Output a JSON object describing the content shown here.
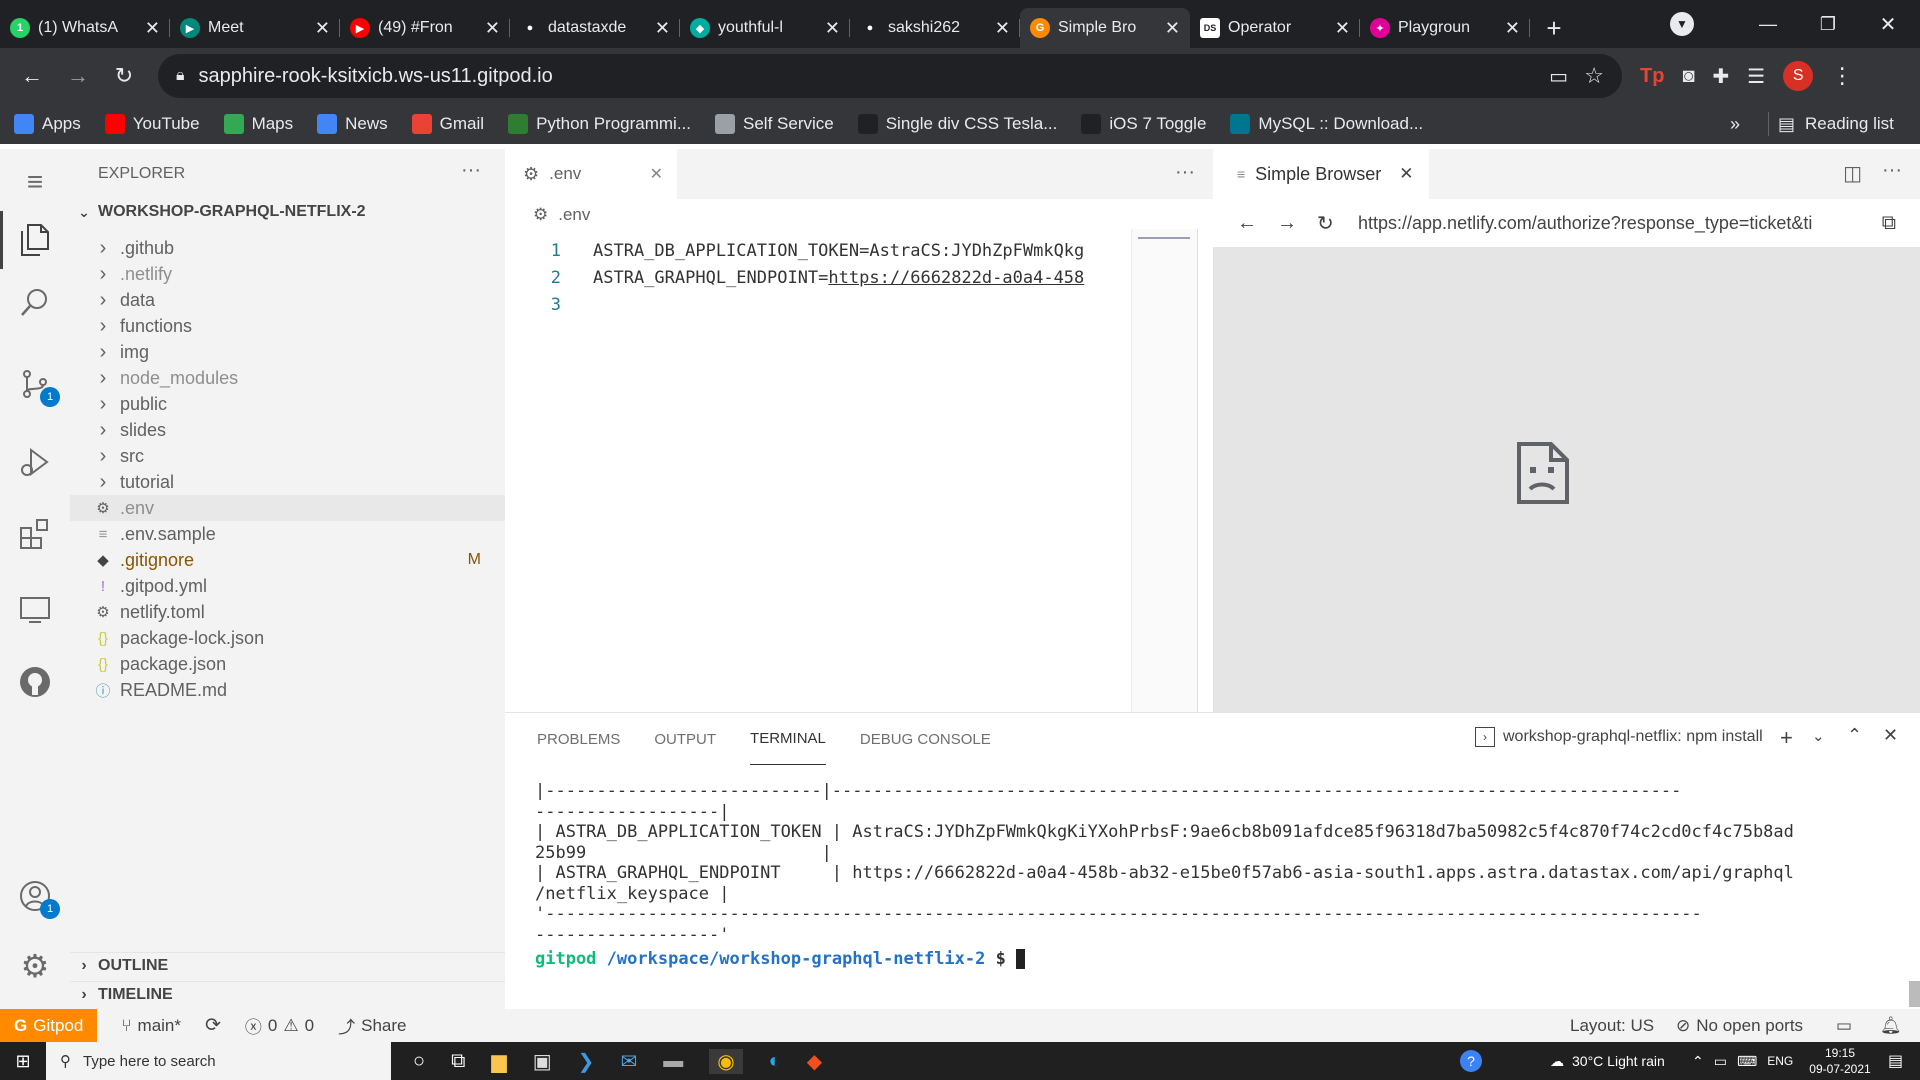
{
  "chrome": {
    "tabs": [
      {
        "title": "(1) WhatsA",
        "color": "#25d366",
        "glyph": "1"
      },
      {
        "title": "Meet",
        "color": "#00897b",
        "glyph": "▶"
      },
      {
        "title": "(49) #Fron",
        "color": "#ff0000",
        "glyph": "▶"
      },
      {
        "title": "datastaxde",
        "color": "#202124",
        "glyph": "●"
      },
      {
        "title": "youthful-l",
        "color": "#00ad9f",
        "glyph": "◆"
      },
      {
        "title": "sakshi262",
        "color": "#202124",
        "glyph": "●"
      },
      {
        "title": "Simple Bro",
        "color": "#ff8a00",
        "glyph": "G",
        "active": true
      },
      {
        "title": "Operator",
        "color": "#ffffff",
        "glyph": "DS"
      },
      {
        "title": "Playgroun",
        "color": "#e10098",
        "glyph": "✦"
      }
    ],
    "url": "sapphire-rook-ksitxicb.ws-us11.gitpod.io",
    "profile_initial": "S",
    "bookmarks": [
      {
        "label": "Apps",
        "icon": "apps-grid-icon",
        "color": "#4285f4"
      },
      {
        "label": "YouTube",
        "icon": "youtube-icon",
        "color": "#ff0000"
      },
      {
        "label": "Maps",
        "icon": "maps-icon",
        "color": "#34a853"
      },
      {
        "label": "News",
        "icon": "news-icon",
        "color": "#4285f4"
      },
      {
        "label": "Gmail",
        "icon": "gmail-icon",
        "color": "#ea4335"
      },
      {
        "label": "Python Programmi...",
        "icon": "python-icon",
        "color": "#2e7d32"
      },
      {
        "label": "Self Service",
        "icon": "globe-icon",
        "color": "#9aa0a6"
      },
      {
        "label": "Single div CSS Tesla...",
        "icon": "codepen-icon",
        "color": "#202124"
      },
      {
        "label": "iOS 7 Toggle",
        "icon": "codepen-icon",
        "color": "#202124"
      },
      {
        "label": "MySQL :: Download...",
        "icon": "mysql-icon",
        "color": "#00758f"
      }
    ],
    "reading_list": "Reading list"
  },
  "explorer": {
    "title": "EXPLORER",
    "project": "WORKSHOP-GRAPHQL-NETFLIX-2",
    "items": [
      {
        "name": ".github",
        "type": "folder"
      },
      {
        "name": ".netlify",
        "type": "folder",
        "dim": true
      },
      {
        "name": "data",
        "type": "folder"
      },
      {
        "name": "functions",
        "type": "folder"
      },
      {
        "name": "img",
        "type": "folder"
      },
      {
        "name": "node_modules",
        "type": "folder",
        "dim": true
      },
      {
        "name": "public",
        "type": "folder"
      },
      {
        "name": "slides",
        "type": "folder"
      },
      {
        "name": "src",
        "type": "folder"
      },
      {
        "name": "tutorial",
        "type": "folder"
      },
      {
        "name": ".env",
        "type": "file",
        "icon": "gear-icon",
        "dim": true,
        "selected": true
      },
      {
        "name": ".env.sample",
        "type": "file",
        "icon": "lines-icon"
      },
      {
        "name": ".gitignore",
        "type": "file",
        "icon": "git-icon",
        "color": "#895503",
        "badge": "M"
      },
      {
        "name": ".gitpod.yml",
        "type": "file",
        "icon": "exclaim-icon"
      },
      {
        "name": "netlify.toml",
        "type": "file",
        "icon": "gear-icon"
      },
      {
        "name": "package-lock.json",
        "type": "file",
        "icon": "braces-icon"
      },
      {
        "name": "package.json",
        "type": "file",
        "icon": "braces-icon"
      },
      {
        "name": "README.md",
        "type": "file",
        "icon": "info-icon"
      }
    ],
    "outline": "OUTLINE",
    "timeline": "TIMELINE",
    "source_control_badge": "1",
    "accounts_badge": "1"
  },
  "editor": {
    "tab": ".env",
    "breadcrumb": ".env",
    "lines": [
      {
        "n": "1",
        "text": "ASTRA_DB_APPLICATION_TOKEN=AstraCS:JYDhZpFWmkQkg"
      },
      {
        "n": "2",
        "text_a": "ASTRA_GRAPHQL_ENDPOINT=",
        "text_b": "https://6662822d-a0a4-458"
      },
      {
        "n": "3",
        "text": ""
      }
    ]
  },
  "simple_browser": {
    "tab": "Simple Browser",
    "url": "https://app.netlify.com/authorize?response_type=ticket&ti"
  },
  "panel": {
    "tabs": [
      "PROBLEMS",
      "OUTPUT",
      "TERMINAL",
      "DEBUG CONSOLE"
    ],
    "active_tab": "TERMINAL",
    "terminal_name": "workshop-graphql-netflix: npm install",
    "lines": [
      "|---------------------------|-----------------------------------------------------------------------------------",
      "------------------|",
      "| ASTRA_DB_APPLICATION_TOKEN | AstraCS:JYDhZpFWmkQkgKiYXohPrbsF:9ae6cb8b091afdce85f96318d7ba50982c5f4c870f74c2cd0cf4c75b8ad",
      "25b99                       |",
      "| ASTRA_GRAPHQL_ENDPOINT     | https://6662822d-a0a4-458b-ab32-e15be0f57ab6-asia-south1.apps.astra.datastax.com/api/graphql",
      "/netflix_keyspace |",
      "'-----------------------------------------------------------------------------------------------------------------",
      "------------------'"
    ],
    "prompt_user": "gitpod",
    "prompt_path": "/workspace/workshop-graphql-netflix-2",
    "prompt_symbol": "$"
  },
  "status": {
    "gitpod": "Gitpod",
    "branch": "main*",
    "errors": "0",
    "warnings": "0",
    "share": "Share",
    "layout": "Layout: US",
    "ports": "No open ports"
  },
  "taskbar": {
    "search_placeholder": "Type here to search",
    "weather": "30°C  Light rain",
    "lang": "ENG",
    "time": "19:15",
    "date": "09-07-2021"
  }
}
